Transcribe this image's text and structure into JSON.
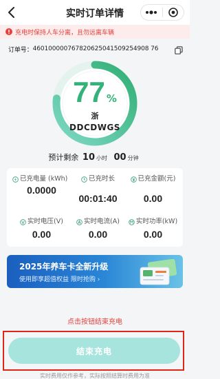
{
  "header": {
    "title": "实时订单详情"
  },
  "notice": {
    "text": "充电时保持人车分离，且勿远离车辆",
    "color": "#e5403b"
  },
  "order": {
    "label": "订单号：",
    "number": "460100000767820625041509254908 76"
  },
  "progress": {
    "percent": 77,
    "percent_text": "77",
    "percent_unit": "%",
    "province": "浙",
    "plate": "DDCDWGS",
    "ring_color": "#33b37a"
  },
  "remaining": {
    "label": "预计剩余",
    "hours": "10",
    "hours_unit": "小时",
    "minutes": "00",
    "minutes_unit": "分钟"
  },
  "metrics": [
    {
      "label": "已充电量 (kWh)",
      "value": "0.0000",
      "icon": "energy-icon"
    },
    {
      "label": "已充时长",
      "value": "00:01:40",
      "icon": "clock-icon"
    },
    {
      "label": "已充金额(元)",
      "value": "0.00",
      "icon": "money-icon"
    },
    {
      "label": "实时电压(V)",
      "value": "0.00",
      "icon": "voltage-icon"
    },
    {
      "label": "实时电流(A)",
      "value": "0.00",
      "icon": "current-icon"
    },
    {
      "label": "实时功率(kW)",
      "value": "0.00",
      "icon": "power-icon"
    }
  ],
  "banner": {
    "title": "2025年养车卡全新升级",
    "subtitle": "使用即享超值权益  限时抢购 ›"
  },
  "hint": "点击按钮结束充电",
  "stop_button": "结束充电",
  "footnote": "实时费用仅作参考，实际按照结算时费用为准"
}
